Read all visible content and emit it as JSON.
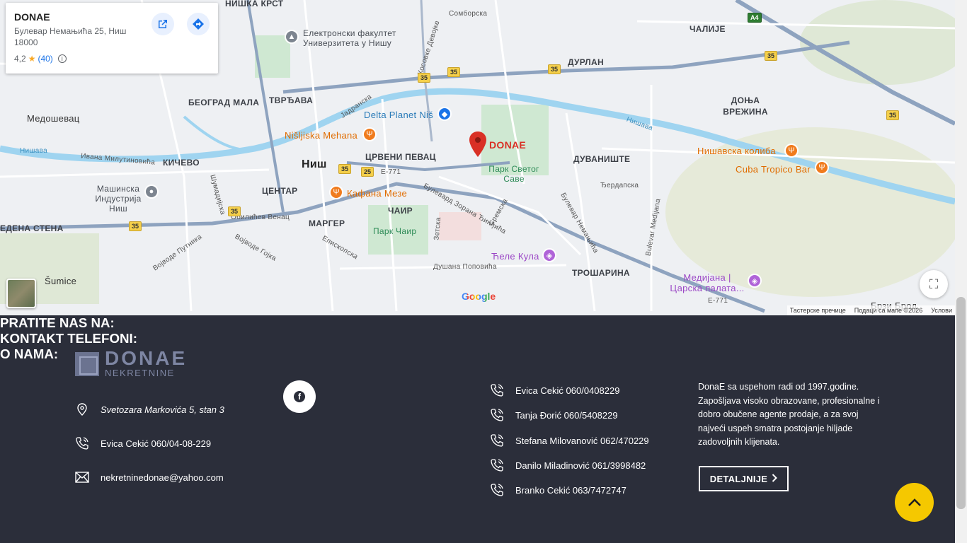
{
  "map": {
    "place_card": {
      "title": "DONAE",
      "address": "Булевар Немањића 25, Ниш 18000",
      "rating": "4,2",
      "review_count": "(40)"
    },
    "labels": {
      "niska_krst": "НИШКА КРСТ",
      "elektronski": "Електронски факултет Универзитета у Нишу",
      "somborska": "Сомборска",
      "calije": "ЧАЛИЈЕ",
      "durlan": "ДУРЛАН",
      "beograd_mala": "БЕОГРАД МАЛА",
      "tvrdava": "ТВРЂАВА",
      "medosevac": "Медошевац",
      "donja_vrezina": "ДОЊА ВРЕЖИНА",
      "delta_planet": "Delta Planet Niš",
      "nisljiska_mehana": "Nišljiska Mehana",
      "donae_pin": "DONAE",
      "crveni_pevac": "ЦРВЕНИ ПЕВАЦ",
      "dubaniste": "ДУВАНИШТЕ",
      "nisavska_koliba": "Нишавска колиба",
      "cuba_tropico": "Cuba Tropico Bar",
      "kicevo": "КИЧЕВО",
      "nis": "Ниш",
      "park_svetog_save": "Парк Светог Саве",
      "masinska": "Машинска Индустрија Ниш",
      "centar": "ЦЕНТАР",
      "kafana_meze": "Кафана Мезе",
      "cair": "ЧАИР",
      "crvena_stena": "ЕДЕНА СТЕНА",
      "margar": "МАРГЕР",
      "park_cair": "Парк Чаир",
      "cele_kula": "Ћеле Кула",
      "trosarina": "ТРОШАРИНА",
      "medijana": "Медијана | Царска палата...",
      "sumice": "Šumice",
      "brzi_brod": "Брзи Брод",
      "nisava": "Нишава",
      "ivana_milutinovica": "Ивана Милутиновића",
      "sumadijska": "Шумадијска",
      "obilicev_venac": "Обилићев Венац",
      "vojvode_gojka": "Војводе Гојка",
      "vojvode_putnika": "Војводе Путника",
      "episkopska": "Епископска",
      "dusana_popovica": "Душана Поповића",
      "bulevar_zorana": "Булевард Зорана Ђинђића",
      "sremska": "Сремска",
      "zetska": "Зетска",
      "bulevar_nemanjica": "Булевар Немањића",
      "bulevar_medijana": "Bulevar Medijana",
      "djerdapska": "Ђердапска",
      "jadranska": "Јадранска",
      "kosovke_devojke": "Косовке Девојке",
      "e771": "E-771",
      "route_35": "35",
      "route_25": "25",
      "a4": "A4",
      "google": "Google"
    },
    "footer": {
      "shortcuts": "Тастерске пречице",
      "map_data": "Подаци са мапе ©2026",
      "terms": "Услови"
    }
  },
  "footer": {
    "logo": {
      "main": "DONAE",
      "sub": "NEKRETNINE"
    },
    "address": "Svetozara Markovića 5, stan 3",
    "phone": "Evica Cekić 060/04-08-229",
    "email": "nekretninedonae@yahoo.com",
    "follow_title": "PRATITE NAS NA:",
    "contacts_title": "KONTAKT TELEFONI:",
    "contacts": [
      "Evica Cekić 060/0408229",
      "Tanja Đorić 060/5408229",
      "Stefana Milovanović 062/470229",
      "Danilo Miladinović 061/3998482",
      "Branko Cekić 063/7472747"
    ],
    "about_title": "O NAMA:",
    "about_text": "DonaE sa uspehom radi od 1997.godine. Zapošljava visoko obrazovane, profesionalne i dobro obučene agente prodaje, a za svoj najveći uspeh smatra postojanje hiljade zadovoljnih klijenata.",
    "details_button": "DETALJNIJE"
  },
  "colors": {
    "accent": "#f5c800",
    "footer_bg": "#2b2e3a",
    "pin": "#d93025"
  }
}
